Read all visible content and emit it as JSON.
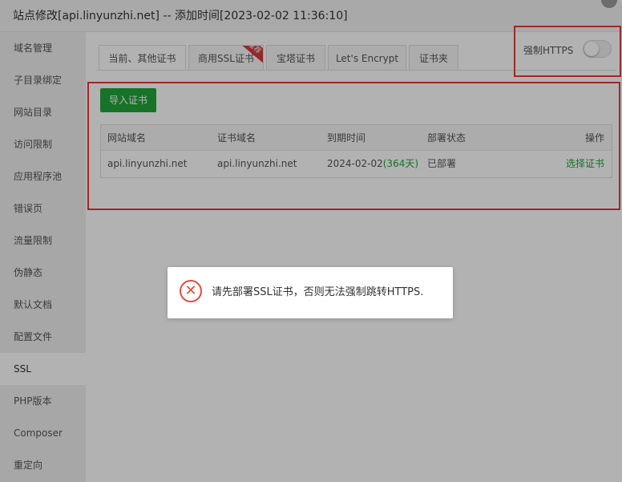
{
  "title": "站点修改[api.linyunzhi.net] -- 添加时间[2023-02-02 11:36:10]",
  "sidebar": {
    "items": [
      {
        "label": "域名管理"
      },
      {
        "label": "子目录绑定"
      },
      {
        "label": "网站目录"
      },
      {
        "label": "访问限制"
      },
      {
        "label": "应用程序池"
      },
      {
        "label": "错误页"
      },
      {
        "label": "流量限制"
      },
      {
        "label": "伪静态"
      },
      {
        "label": "默认文档"
      },
      {
        "label": "配置文件"
      },
      {
        "label": "SSL"
      },
      {
        "label": "PHP版本"
      },
      {
        "label": "Composer"
      },
      {
        "label": "重定向"
      }
    ],
    "active_index": 10
  },
  "tabs": [
    {
      "label": "当前、其他证书"
    },
    {
      "label": "商用SSL证书",
      "badge": "推荐"
    },
    {
      "label": "宝塔证书"
    },
    {
      "label": "Let's Encrypt"
    },
    {
      "label": "证书夹"
    }
  ],
  "active_tab": 0,
  "force_https": {
    "label": "强制HTTPS",
    "enabled": false
  },
  "import_button": "导入证书",
  "table": {
    "headers": [
      "网站域名",
      "证书域名",
      "到期时间",
      "部署状态",
      "操作"
    ],
    "rows": [
      {
        "site": "api.linyunzhi.net",
        "cert": "api.linyunzhi.net",
        "expire": "2024-02-02",
        "days": "(364天)",
        "status": "已部署",
        "action": "选择证书"
      }
    ]
  },
  "dialog": {
    "message": "请先部署SSL证书，否则无法强制跳转HTTPS.",
    "icon": "error-icon"
  },
  "colors": {
    "accent": "#20a53a",
    "highlight": "#e53935",
    "error": "#e74c3c"
  }
}
